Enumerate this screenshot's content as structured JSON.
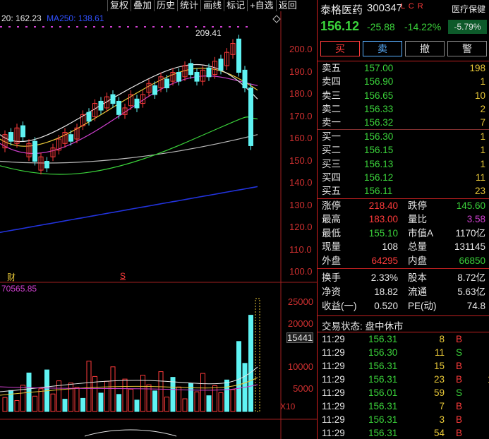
{
  "toolbar": [
    "复权",
    "叠加",
    "历史",
    "统计",
    "画线",
    "标记",
    "+自选",
    "返回"
  ],
  "ma_legend": {
    "ma20": "20: 162.23",
    "ma250": "MA250: 138.61"
  },
  "chart_annotations": {
    "high_label": "209.41",
    "event_cai": "财",
    "event_s": "S"
  },
  "price_axis": [
    "200.0",
    "190.0",
    "180.0",
    "170.0",
    "160.0",
    "150.0",
    "140.0",
    "130.0",
    "120.0",
    "110.0",
    "100.0"
  ],
  "volume": {
    "legend": "70565.85",
    "axis": [
      "25000",
      "20000",
      "15441",
      "10000",
      "5000"
    ],
    "multiplier": "X10"
  },
  "stock": {
    "name": "泰格医药",
    "code": "300347",
    "tags": "L C R",
    "sector": "医疗保健",
    "sector_change": "-5.79%",
    "price": "156.12",
    "change": "-25.88",
    "change_pct": "-14.22%"
  },
  "buttons": {
    "buy": "买",
    "sell": "卖",
    "cancel": "撤",
    "alert": "警"
  },
  "asks": [
    {
      "label": "卖五",
      "price": "157.00",
      "vol": "198"
    },
    {
      "label": "卖四",
      "price": "156.90",
      "vol": "1"
    },
    {
      "label": "卖三",
      "price": "156.65",
      "vol": "10"
    },
    {
      "label": "卖二",
      "price": "156.33",
      "vol": "2"
    },
    {
      "label": "卖一",
      "price": "156.32",
      "vol": "7"
    }
  ],
  "bids": [
    {
      "label": "买一",
      "price": "156.30",
      "vol": "1"
    },
    {
      "label": "买二",
      "price": "156.15",
      "vol": "1"
    },
    {
      "label": "买三",
      "price": "156.13",
      "vol": "1"
    },
    {
      "label": "买四",
      "price": "156.12",
      "vol": "11"
    },
    {
      "label": "买五",
      "price": "156.11",
      "vol": "23"
    }
  ],
  "stats": [
    {
      "l1": "涨停",
      "v1": "218.40",
      "c1": "red",
      "l2": "跌停",
      "v2": "145.60",
      "c2": "green"
    },
    {
      "l1": "最高",
      "v1": "183.00",
      "c1": "red",
      "l2": "量比",
      "v2": "3.58",
      "c2": "purple"
    },
    {
      "l1": "最低",
      "v1": "155.10",
      "c1": "green",
      "l2": "市值A",
      "v2": "1170亿",
      "c2": "white"
    },
    {
      "l1": "现量",
      "v1": "108",
      "c1": "white",
      "l2": "总量",
      "v2": "131145",
      "c2": "white"
    },
    {
      "l1": "外盘",
      "v1": "64295",
      "c1": "red",
      "l2": "内盘",
      "v2": "66850",
      "c2": "green"
    }
  ],
  "stats2": [
    {
      "l1": "换手",
      "v1": "2.33%",
      "l2": "股本",
      "v2": "8.72亿"
    },
    {
      "l1": "净资",
      "v1": "18.82",
      "l2": "流通",
      "v2": "5.63亿"
    },
    {
      "l1": "收益(一)",
      "v1": "0.520",
      "l2": "PE(动)",
      "v2": "74.8"
    }
  ],
  "trade_status": "交易状态: 盘中休市",
  "trades": [
    {
      "time": "11:29",
      "price": "156.31",
      "vol": "8",
      "side": "B",
      "n": "5"
    },
    {
      "time": "11:29",
      "price": "156.30",
      "vol": "11",
      "side": "S",
      "n": "9"
    },
    {
      "time": "11:29",
      "price": "156.31",
      "vol": "15",
      "side": "B",
      "n": "5"
    },
    {
      "time": "11:29",
      "price": "156.31",
      "vol": "23",
      "side": "B",
      "n": "10"
    },
    {
      "time": "11:29",
      "price": "156.01",
      "vol": "59",
      "side": "S",
      "n": "11"
    },
    {
      "time": "11:29",
      "price": "156.31",
      "vol": "7",
      "side": "B",
      "n": "4"
    },
    {
      "time": "11:29",
      "price": "156.31",
      "vol": "3",
      "side": "B",
      "n": "2"
    },
    {
      "time": "11:29",
      "price": "156.31",
      "vol": "54",
      "side": "B",
      "n": "5"
    }
  ],
  "colors": {
    "up": "#ff3b3b",
    "down": "#3bd43b",
    "cyan": "#5ff3f3",
    "ma5": "#e6e6e6",
    "ma10": "#e8c838",
    "ma20": "#d040d0",
    "ma60": "#3bd43b",
    "ma120": "#aaaaaa",
    "ma250": "#2233dd"
  }
}
